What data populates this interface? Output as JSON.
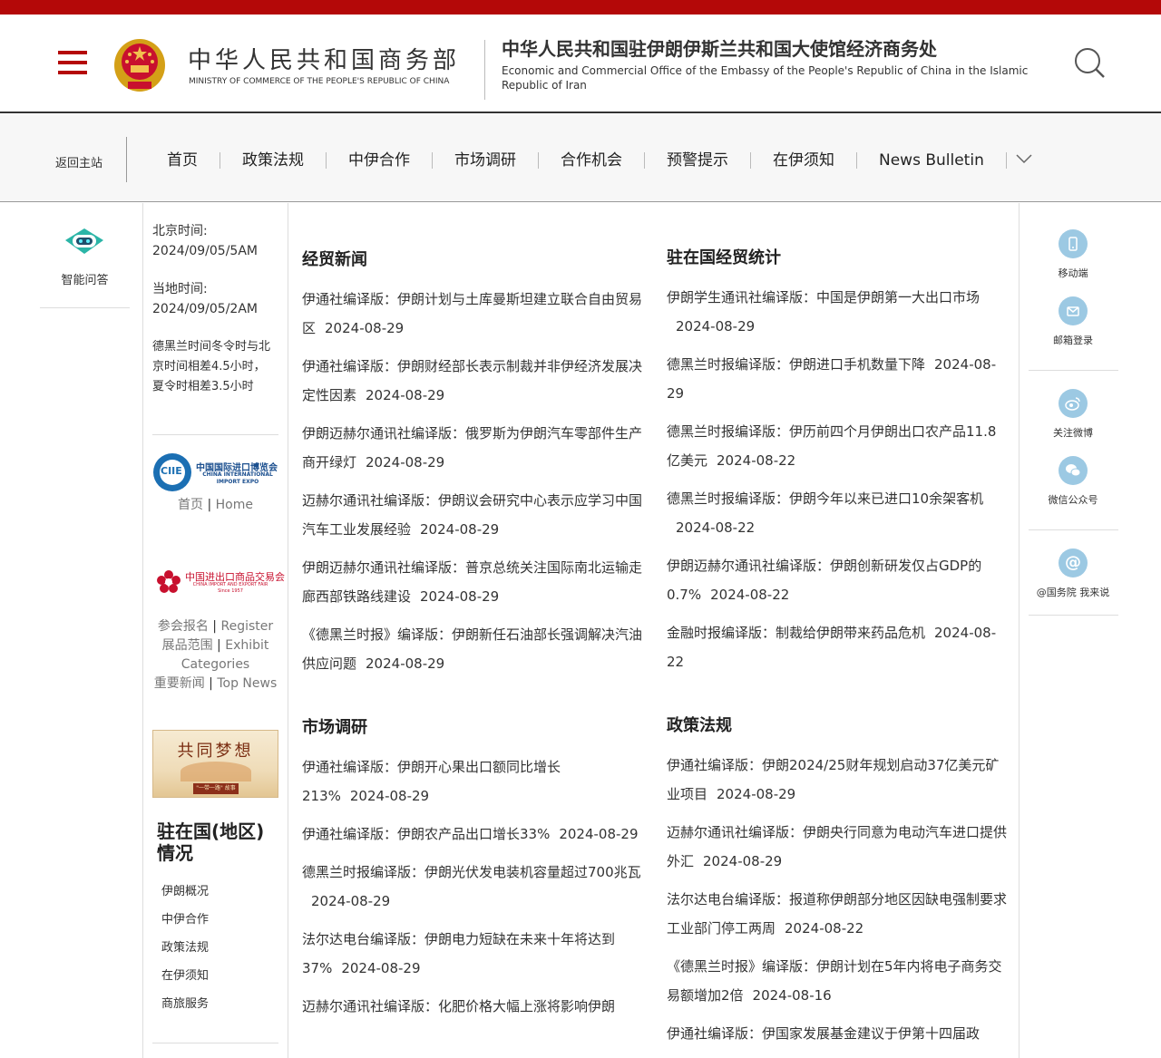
{
  "header": {
    "ministry_cn": "中华人民共和国商务部",
    "ministry_en": "MINISTRY OF COMMERCE OF THE PEOPLE'S REPUBLIC OF CHINA",
    "office_cn": "中华人民共和国驻伊朗伊斯兰共和国大使馆经济商务处",
    "office_en": "Economic and Commercial Office of the Embassy of the People's Republic of China in the Islamic Republic of Iran"
  },
  "nav": {
    "home": "返回主站",
    "items": [
      "首页",
      "政策法规",
      "中伊合作",
      "市场调研",
      "合作机会",
      "预警提示",
      "在伊须知",
      "News Bulletin"
    ]
  },
  "left": {
    "assistant_label": "智能问答"
  },
  "sidebar": {
    "beijing_label": "北京时间:",
    "beijing_time": "2024/09/05/5AM",
    "local_label": "当地时间:",
    "local_time": "2024/09/05/2AM",
    "tz_note": "德黑兰时间冬令时与北京时间相差4.5小时，夏令时相差3.5小时",
    "ciie_name_cn": "中国国际进口博览会",
    "ciie_name_en": "CHINA INTERNATIONAL IMPORT EXPO",
    "ciie_abbr": "CIIE",
    "ciie_home_cn": "首页",
    "ciie_home_en": "Home",
    "canton_name_cn": "中国进出口商品交易会",
    "canton_name_en": "CHINA IMPORT AND EXPORT FAIR",
    "canton_since": "Since 1957",
    "canton_links": [
      {
        "cn": "参会报名",
        "en": "Register"
      },
      {
        "cn": "展品范围",
        "en": "Exhibit Categories"
      },
      {
        "cn": "重要新闻",
        "en": "Top News"
      }
    ],
    "dream_text": "共同梦想",
    "dream_sub": "\"一带一路\" 故事",
    "region_title": "驻在国(地区)情况",
    "region_items": [
      "伊朗概况",
      "中伊合作",
      "政策法规",
      "在伊须知",
      "商旅服务"
    ]
  },
  "main": {
    "sections": [
      {
        "title": "经贸新闻",
        "items": [
          {
            "text": "伊通社编译版：伊朗计划与土库曼斯坦建立联合自由贸易区",
            "date": "2024-08-29"
          },
          {
            "text": "伊通社编译版：伊朗财经部长表示制裁并非伊经济发展决定性因素",
            "date": "2024-08-29"
          },
          {
            "text": "伊朗迈赫尔通讯社编译版：俄罗斯为伊朗汽车零部件生产商开绿灯",
            "date": "2024-08-29"
          },
          {
            "text": "迈赫尔通讯社编译版：伊朗议会研究中心表示应学习中国汽车工业发展经验",
            "date": "2024-08-29"
          },
          {
            "text": "伊朗迈赫尔通讯社编译版：普京总统关注国际南北运输走廊西部铁路线建设",
            "date": "2024-08-29"
          },
          {
            "text": "《德黑兰时报》编译版：伊朗新任石油部长强调解决汽油供应问题",
            "date": "2024-08-29"
          }
        ]
      },
      {
        "title": "驻在国经贸统计",
        "items": [
          {
            "text": "伊朗学生通讯社编译版：中国是伊朗第一大出口市场",
            "date": "2024-08-29"
          },
          {
            "text": "德黑兰时报编译版：伊朗进口手机数量下降",
            "date": "2024-08-29"
          },
          {
            "text": "德黑兰时报编译版：伊历前四个月伊朗出口农产品11.8亿美元",
            "date": "2024-08-22"
          },
          {
            "text": "德黑兰时报编译版：伊朗今年以来已进口10余架客机",
            "date": "2024-08-22"
          },
          {
            "text": "伊朗迈赫尔通讯社编译版：伊朗创新研发仅占GDP的0.7%",
            "date": "2024-08-22"
          },
          {
            "text": "金融时报编译版：制裁给伊朗带来药品危机",
            "date": "2024-08-22"
          }
        ]
      },
      {
        "title": "市场调研",
        "items": [
          {
            "text": "伊通社编译版：伊朗开心果出口额同比增长213%",
            "date": "2024-08-29"
          },
          {
            "text": "伊通社编译版：伊朗农产品出口增长33%",
            "date": "2024-08-29"
          },
          {
            "text": "德黑兰时报编译版：伊朗光伏发电装机容量超过700兆瓦",
            "date": "2024-08-29"
          },
          {
            "text": "法尔达电台编译版：伊朗电力短缺在未来十年将达到37%",
            "date": "2024-08-29"
          },
          {
            "text": "迈赫尔通讯社编译版：化肥价格大幅上涨将影响伊朗",
            "date": ""
          }
        ]
      },
      {
        "title": "政策法规",
        "items": [
          {
            "text": "伊通社编译版：伊朗2024/25财年规划启动37亿美元矿业项目",
            "date": "2024-08-29"
          },
          {
            "text": "迈赫尔通讯社编译版：伊朗央行同意为电动汽车进口提供外汇",
            "date": "2024-08-29"
          },
          {
            "text": "法尔达电台编译版：报道称伊朗部分地区因缺电强制要求工业部门停工两周",
            "date": "2024-08-22"
          },
          {
            "text": "《德黑兰时报》编译版：伊朗计划在5年内将电子商务交易额增加2倍",
            "date": "2024-08-16"
          },
          {
            "text": "伊通社编译版：伊国家发展基金建议于伊第十四届政",
            "date": ""
          }
        ]
      }
    ]
  },
  "right": {
    "items": [
      {
        "label": "移动端",
        "icon": "mobile-icon"
      },
      {
        "label": "邮箱登录",
        "icon": "mail-icon"
      },
      {
        "label": "关注微博",
        "icon": "weibo-icon"
      },
      {
        "label": "微信公众号",
        "icon": "wechat-icon"
      },
      {
        "label": "@国务院 我来说",
        "icon": "at-icon"
      }
    ]
  },
  "colors": {
    "brand_red": "#b40808",
    "icon_blue": "#9cc9e3",
    "robot_teal": "#2bb5a7"
  }
}
